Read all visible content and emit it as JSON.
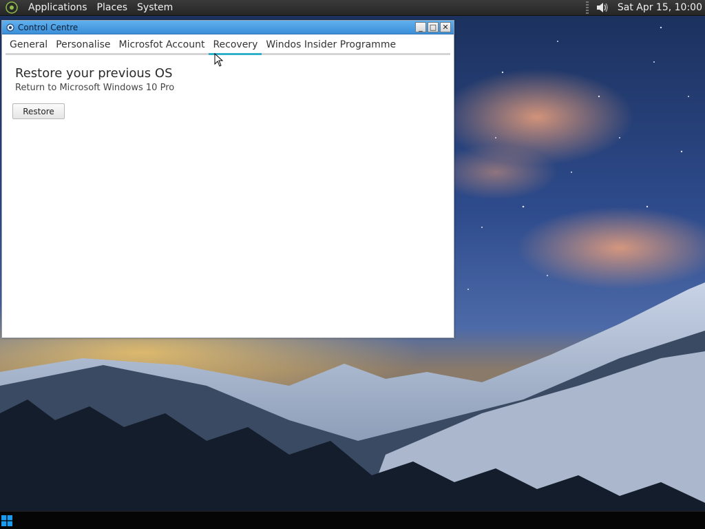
{
  "panel": {
    "menus": [
      "Applications",
      "Places",
      "System"
    ],
    "clock": "Sat Apr 15, 10:00",
    "icons": {
      "logo": "gnome-foot-icon",
      "tray": "speaker-icon"
    }
  },
  "window": {
    "title": "Control Centre",
    "controls": {
      "minimize": "_",
      "maximize": "□",
      "close": "✕"
    },
    "tabs": [
      {
        "label": "General"
      },
      {
        "label": "Personalise"
      },
      {
        "label": "Microsfot Account"
      },
      {
        "label": "Recovery"
      },
      {
        "label": "Windos Insider Programme"
      }
    ],
    "active_tab": "Recovery",
    "content": {
      "title": "Restore your previous OS",
      "subtitle": "Return to Microsoft Windows 10 Pro",
      "restore_label": "Restore"
    }
  },
  "taskbar": {
    "start_icon": "windows-logo-icon"
  },
  "colors": {
    "titlebar": "#3b8fd8",
    "active_tab_indicator": "#2fb0c8",
    "panel": "#2e2e2e",
    "taskbar": "#050505"
  }
}
